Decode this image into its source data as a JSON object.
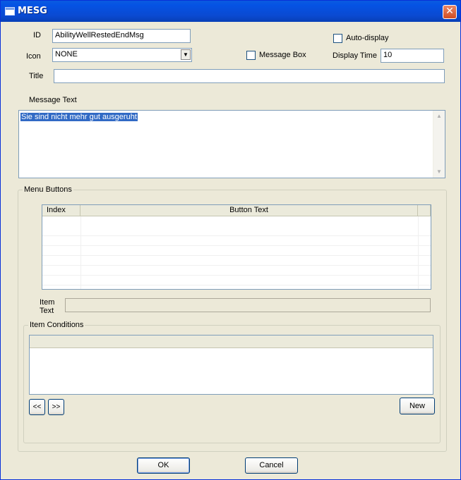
{
  "window": {
    "title": "MESG",
    "close_glyph": "✕"
  },
  "form": {
    "id_label": "ID",
    "id_value": "AbilityWellRestedEndMsg",
    "icon_label": "Icon",
    "icon_value": "NONE",
    "title_label": "Title",
    "title_value": "",
    "auto_display_label": "Auto-display",
    "auto_display_checked": false,
    "message_box_label": "Message Box",
    "message_box_checked": false,
    "display_time_label": "Display Time",
    "display_time_value": "10",
    "message_text_label": "Message Text",
    "message_text_value": "Sie sind nicht mehr gut ausgeruht"
  },
  "menu_buttons": {
    "legend": "Menu Buttons",
    "columns": [
      "Index",
      "Button Text"
    ],
    "rows": [],
    "item_text_label": "Item\nText",
    "item_text_label_line1": "Item",
    "item_text_label_line2": "Text",
    "item_text_value": ""
  },
  "item_conditions": {
    "legend": "Item Conditions",
    "prev_label": "<<",
    "next_label": ">>",
    "new_label": "New"
  },
  "footer": {
    "ok_label": "OK",
    "cancel_label": "Cancel"
  },
  "colors": {
    "titlebar": "#0a4ad2",
    "selection": "#316ac5",
    "face": "#ece9d8"
  }
}
